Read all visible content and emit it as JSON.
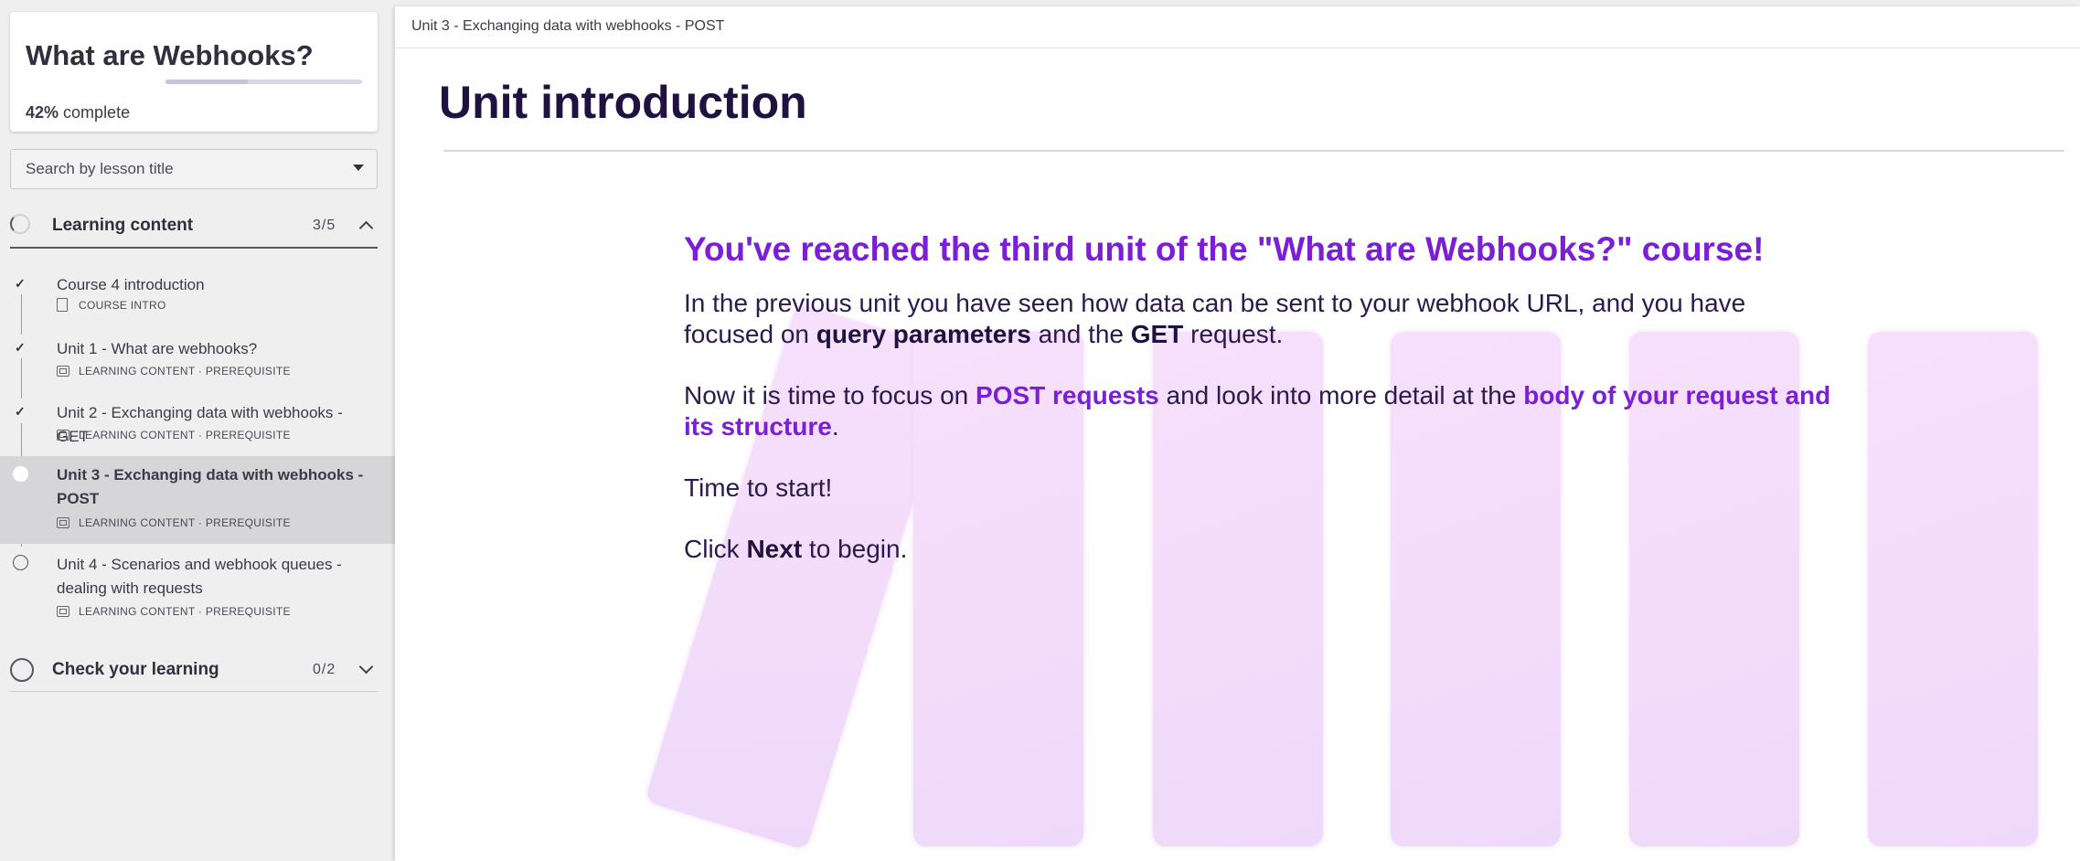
{
  "sidebar": {
    "course_title": "What are Webhooks?",
    "progress_percent": "42%",
    "progress_label": "complete",
    "progress_fraction": 0.42,
    "search_placeholder": "Search by lesson title",
    "sections": [
      {
        "title": "Learning content",
        "count": "3/5",
        "expanded": true,
        "lessons": [
          {
            "title": "Course 4 introduction",
            "meta": "COURSE INTRO",
            "status": "complete",
            "icon": "document-icon"
          },
          {
            "title": "Unit 1 - What are webhooks?",
            "meta": "LEARNING CONTENT · PREREQUISITE",
            "status": "complete",
            "icon": "slides-icon"
          },
          {
            "title": "Unit 2 - Exchanging data with webhooks - GET",
            "meta": "LEARNING CONTENT · PREREQUISITE",
            "status": "complete",
            "icon": "slides-icon"
          },
          {
            "title": "Unit 3 - Exchanging data with webhooks - POST",
            "meta": "LEARNING CONTENT · PREREQUISITE",
            "status": "current",
            "icon": "slides-icon"
          },
          {
            "title": "Unit 4 - Scenarios and webhook queues - dealing with requests",
            "meta": "LEARNING CONTENT · PREREQUISITE",
            "status": "not-started",
            "icon": "slides-icon"
          }
        ]
      },
      {
        "title": "Check your learning",
        "count": "0/2",
        "expanded": false
      }
    ]
  },
  "main": {
    "topbar_title": "Unit 3 - Exchanging data with webhooks - POST",
    "heading": "Unit introduction",
    "lead": "You've reached the third unit of the \"What are Webhooks?\" course!",
    "p1_a": "In the previous unit you have seen how data can be sent to your webhook URL, and you have focused on ",
    "p1_b": "query parameters",
    "p1_c": " and the ",
    "p1_d": "GET",
    "p1_e": " request.",
    "p2_a": "Now it is time to focus on ",
    "p2_b": "POST requests",
    "p2_c": " and look into more detail at the ",
    "p2_d": "body of your request and its structure",
    "p2_e": ".",
    "p3": "Time to start!",
    "p4_a": "Click ",
    "p4_b": "Next",
    "p4_c": " to begin."
  },
  "colors": {
    "accent": "#7a1fd6",
    "heading": "#1f1140",
    "decorative_bars": "#f5dffb"
  }
}
